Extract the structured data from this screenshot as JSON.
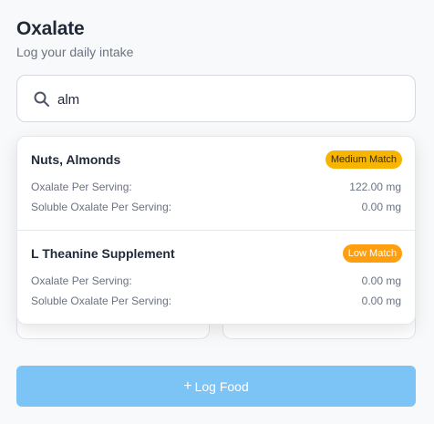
{
  "header": {
    "title": "Oxalate",
    "subtitle": "Log your daily intake"
  },
  "search": {
    "value": "alm",
    "icon": "search-icon"
  },
  "results": [
    {
      "name": "Nuts, Almonds",
      "badge": "Medium Match",
      "badge_color": "#f7b500",
      "oxalate_label": "Oxalate Per Serving:",
      "oxalate_value": "122.00 mg",
      "soluble_label": "Soluble Oxalate Per Serving:",
      "soluble_value": "0.00 mg"
    },
    {
      "name": "L Theanine Supplement",
      "badge": "Low Match",
      "badge_color": "#ff9f0f",
      "oxalate_label": "Oxalate Per Serving:",
      "oxalate_value": "0.00 mg",
      "soluble_label": "Soluble Oxalate Per Serving:",
      "soluble_value": "0.00 mg"
    }
  ],
  "log_button": {
    "icon": "+",
    "label": "Log Food",
    "color": "#7cc4f5"
  }
}
